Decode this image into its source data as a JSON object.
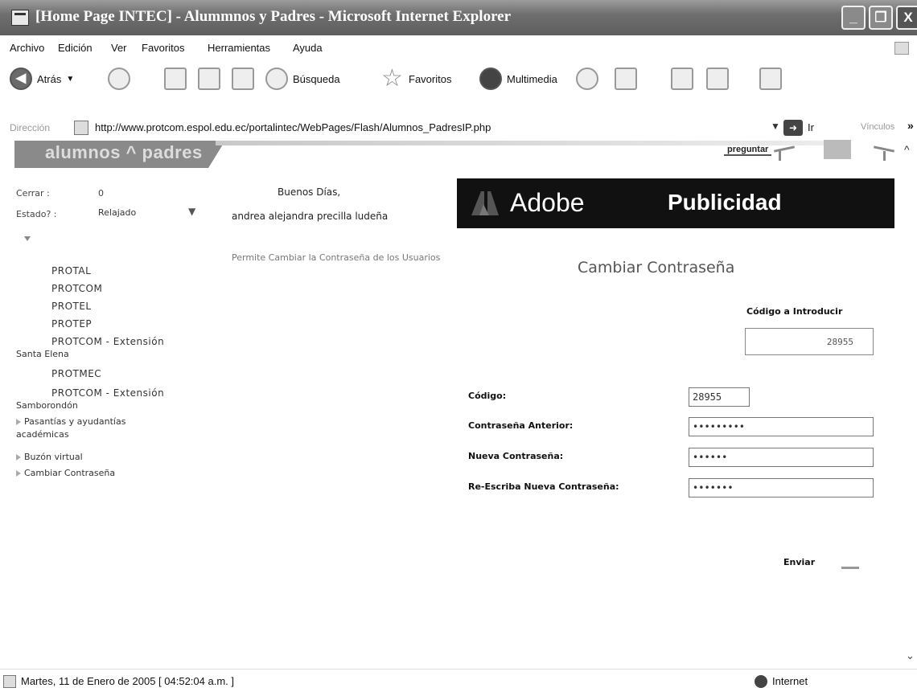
{
  "window": {
    "title": "[Home Page INTEC] - Alummnos y Padres - Microsoft Internet Explorer",
    "min_label": "_",
    "max_label": "❐",
    "close_label": "X"
  },
  "menubar": {
    "items": [
      "Archivo",
      "Edición",
      "Ver",
      "Favoritos",
      "Herramientas",
      "Ayuda"
    ]
  },
  "toolbar": {
    "back": "Atrás",
    "search": "Búsqueda",
    "favorites": "Favoritos",
    "media": "Multimedia"
  },
  "address": {
    "label": "Dirección",
    "url": "http://www.protcom.espol.edu.ec/portalintec/WebPages/Flash/Alumnos_PadresIP.php",
    "go": "Ir",
    "links": "Vínculos",
    "more": "»"
  },
  "page": {
    "banner_text": "alumnos ^ padres",
    "preguntar": "preguntar",
    "cerrar_label": "Cerrar :",
    "cerrar_value": "0",
    "estado_label": "Estado? :",
    "estado_value": "Relajado",
    "greeting": "Buenos Días,",
    "user_name": "andrea alejandra precilla ludeña",
    "description": "Permite Cambiar la Contraseña de los Usuarios",
    "ad_brand": "Adobe",
    "ad_text": "Publicidad"
  },
  "menu": {
    "sub_items": [
      "PROTAL",
      "PROTCOM",
      "PROTEL",
      "PROTEP",
      "PROTCOM - Extensión",
      "Santa Elena",
      "PROTMEC",
      "PROTCOM - Extensión",
      "Samborondón"
    ],
    "items": [
      "Pasantías y ayudantías",
      "académicas",
      "Buzón virtual",
      "Cambiar Contraseña"
    ]
  },
  "form": {
    "title": "Cambiar Contraseña",
    "code_label": "Código a Introducir",
    "code_value": "28955",
    "fields": {
      "codigo_label": "Código:",
      "codigo_value": "28955",
      "anterior_label": "Contraseña Anterior:",
      "anterior_value": "•••••••••",
      "nueva_label": "Nueva Contraseña:",
      "nueva_value": "••••••",
      "reescriba_label": "Re-Escriba Nueva Contraseña:",
      "reescriba_value": "•••••••"
    },
    "submit": "Enviar"
  },
  "status": {
    "text": "Martes, 11 de Enero de 2005    [ 04:52:04 a.m. ]",
    "zone": "Internet"
  },
  "colors": {
    "titlebar": "#6f6f6f",
    "ad_background": "#111111",
    "banner": "#8a8a8a"
  }
}
